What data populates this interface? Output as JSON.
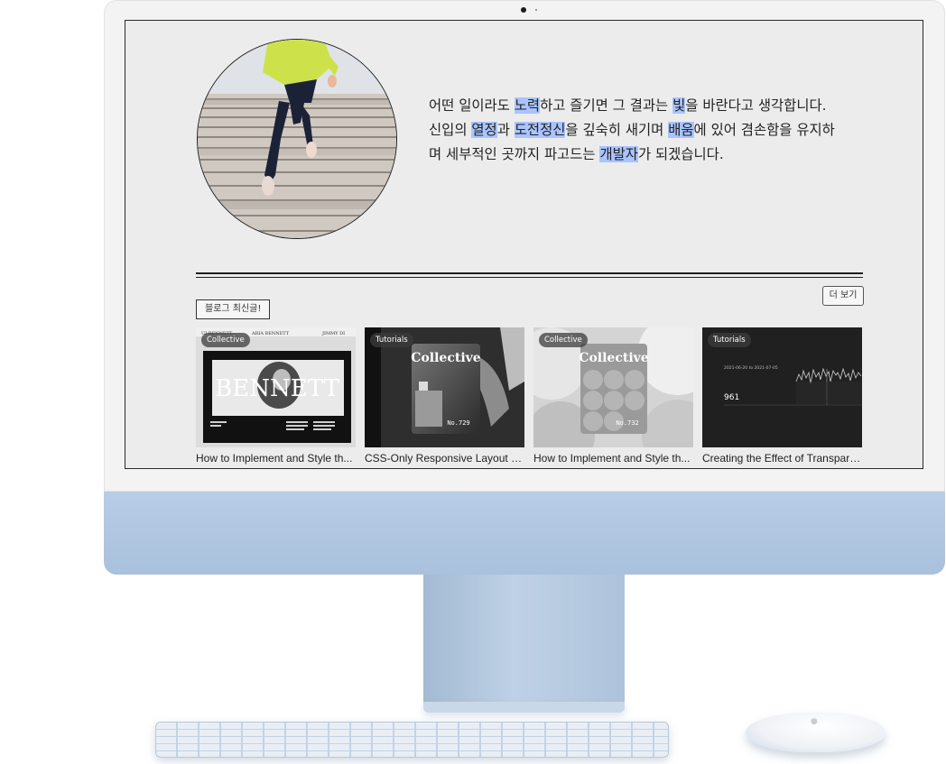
{
  "intro": {
    "segments": [
      {
        "text": "어떤 일이라도 ",
        "hl": false
      },
      {
        "text": "노력",
        "hl": true
      },
      {
        "text": "하고 즐기면 그 결과는 ",
        "hl": false
      },
      {
        "text": "빛",
        "hl": true
      },
      {
        "text": "을 바란다고 생각합니다. 신입의 ",
        "hl": false
      },
      {
        "text": "열정",
        "hl": true
      },
      {
        "text": "과 ",
        "hl": false
      },
      {
        "text": "도전정신",
        "hl": true
      },
      {
        "text": "을 깊숙히 새기며 ",
        "hl": false
      },
      {
        "text": "배움",
        "hl": true
      },
      {
        "text": "에 있어 겸손함을 유지하며 세부적인 곳까지 파고드는 ",
        "hl": false
      },
      {
        "text": "개발자",
        "hl": true
      },
      {
        "text": "가 되겠습니다.",
        "hl": false
      }
    ],
    "highlight_color": "#a9c4ff"
  },
  "blog": {
    "section_label": "블로그 최신글!",
    "more_label": "더 보기",
    "cards": [
      {
        "tag": "Collective",
        "title": "How to Implement and Style th...",
        "thumb": {
          "brand": "BENNETT",
          "header_left": "UI BENNETT",
          "header_mid": "ARIA BENNETT",
          "header_right": "JIMMY DI"
        }
      },
      {
        "tag": "Tutorials",
        "title": "CSS-Only Responsive Layout wit...",
        "thumb": {
          "brand": "Collective",
          "number": "No.729"
        }
      },
      {
        "tag": "Collective",
        "title": "How to Implement and Style th...",
        "thumb": {
          "brand": "Collective",
          "number": "No.732"
        }
      },
      {
        "tag": "Tutorials",
        "title": "Creating the Effect of Transpare...",
        "thumb": {
          "date_range": "2021-06-20 to 2021-07-05",
          "value": "961"
        }
      }
    ]
  },
  "colors": {
    "screen_bg": "#ececec",
    "chin": "#b8cde6"
  }
}
